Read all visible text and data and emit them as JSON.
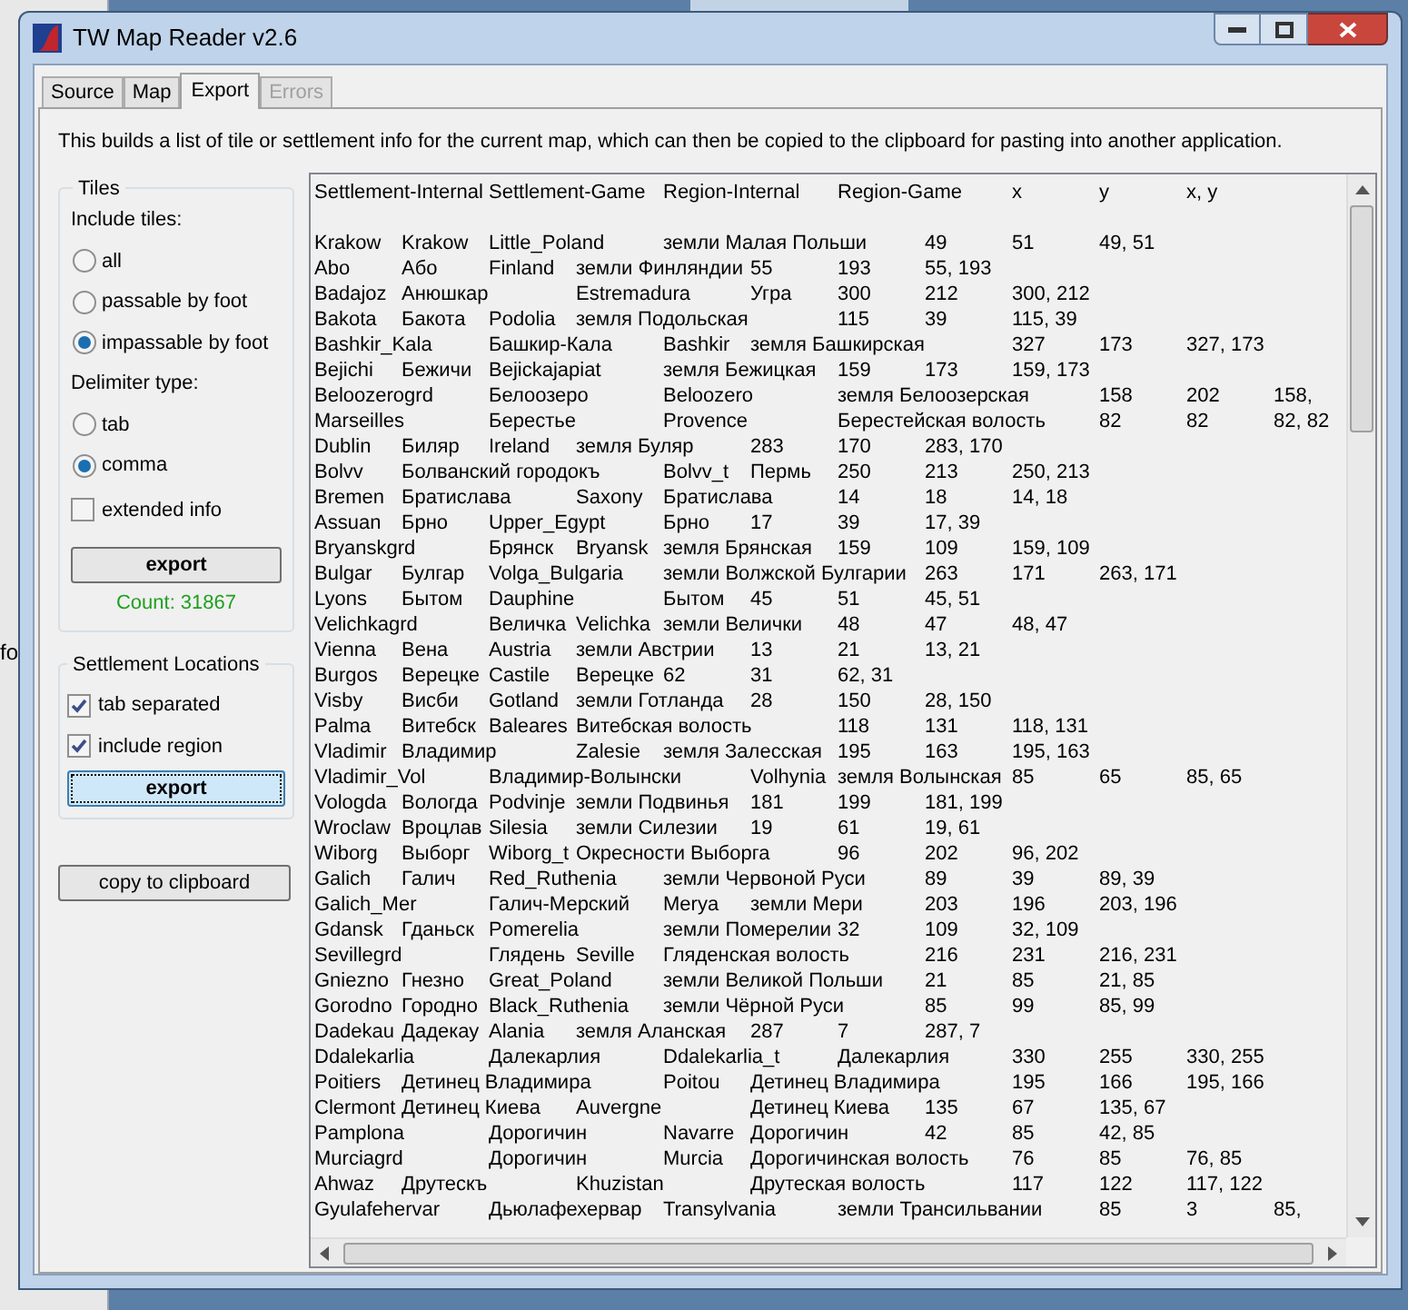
{
  "window": {
    "title": "TW Map Reader v2.6"
  },
  "tabs": [
    {
      "label": "Source",
      "selected": false,
      "disabled": false
    },
    {
      "label": "Map",
      "selected": false,
      "disabled": false
    },
    {
      "label": "Export",
      "selected": true,
      "disabled": false
    },
    {
      "label": "Errors",
      "selected": false,
      "disabled": true
    }
  ],
  "description": "This builds a list of tile or settlement info for the current map, which can then be copied to the clipboard for pasting into another application.",
  "tiles": {
    "title": "Tiles",
    "include_label": "Include tiles:",
    "include_options": [
      {
        "label": "all",
        "selected": false
      },
      {
        "label": "passable by foot",
        "selected": false
      },
      {
        "label": "impassable by foot",
        "selected": true
      }
    ],
    "delimiter_label": "Delimiter type:",
    "delimiter_options": [
      {
        "label": "tab",
        "selected": false
      },
      {
        "label": "comma",
        "selected": true
      }
    ],
    "extended_info": {
      "label": "extended info",
      "checked": false
    },
    "export_button": {
      "label": "export",
      "focused": false
    },
    "count": "Count: 31867"
  },
  "settlement_locations": {
    "title": "Settlement Locations",
    "options": [
      {
        "label": "tab separated",
        "checked": true
      },
      {
        "label": "include region",
        "checked": true
      }
    ],
    "export_button": {
      "label": "export",
      "focused": true
    }
  },
  "copy_button": {
    "label": "copy to clipboard"
  },
  "output": {
    "header": "Settlement-Internal\tSettlement-Game\tRegion-Internal\tRegion-Game\tx\ty\tx, y",
    "rows": [
      "Krakow\tKrakow\tLittle_Poland\tземли Малая Польши\t49\t51\t49, 51",
      "Abo\tАбо\tFinland\tземли Финляндии\t55\t193\t55, 193",
      "Badajoz\tАнюшкар\tEstremadura\tУгра\t300\t212\t300, 212",
      "Bakota\tБакота\tPodolia\tземля Подольская\t115\t39\t115, 39",
      "Bashkir_Kala\tБашкир-Кала\tBashkir\tземля Башкирская\t327\t173\t327, 173",
      "Bejichi\tБежичи\tBejickajapiat\tземля Бежицкая\t159\t173\t159, 173",
      "Beloozerogrd\tБелоозеро\tBeloozero\tземля Белоозерская\t158\t202\t158,",
      "Marseilles\tБерестье\tProvence\tБерестейская волость\t82\t82\t82, 82",
      "Dublin\tБиляр\tIreland\tземля Буляр\t283\t170\t283, 170",
      "Bolvv\tБолванский городокъ\tBolvv_t\tПермь\t250\t213\t250, 213",
      "Bremen\tБратислава\tSaxony\tБратислава\t14\t18\t14, 18",
      "Assuan\tБрно\tUpper_Egypt\tБрно\t17\t39\t17, 39",
      "Bryanskgrd\tБрянск\tBryansk\tземля Брянская\t159\t109\t159, 109",
      "Bulgar\tБулгар\tVolga_Bulgaria\tземли Волжской Булгарии\t263\t171\t263, 171",
      "Lyons\tБытом\tDauphine\tБытом\t45\t51\t45, 51",
      "Velichkagrd\tВеличка\tVelichka\tземли Велички\t48\t47\t48, 47",
      "Vienna\tВена\tAustria\tземли Австрии\t13\t21\t13, 21",
      "Burgos\tВерецке\tCastile\tВерецке\t62\t31\t62, 31",
      "Visby\tВисби\tGotland\tземли Готланда\t28\t150\t28, 150",
      "Palma\tВитебск\tBaleares\tВитебская волость\t118\t131\t118, 131",
      "Vladimir\tВладимир\tZalesie\tземля Залесская\t195\t163\t195, 163",
      "Vladimir_Vol\tВладимир-Волынски\tVolhynia\tземля Волынская\t85\t65\t85, 65",
      "Vologda\tВологда\tPodvinje\tземли Подвинья\t181\t199\t181, 199",
      "Wroclaw\tВроцлав\tSilesia\tземли Силезии\t19\t61\t19, 61",
      "Wiborg\tВыборг\tWiborg_t\tОкресности Выборга\t96\t202\t96, 202",
      "Galich\tГалич\tRed_Ruthenia\tземли Червоной Руси\t89\t39\t89, 39",
      "Galich_Mer\tГалич-Мерский\tMerya\tземли Мери\t203\t196\t203, 196",
      "Gdansk\tГданьск\tPomerelia\tземли Померелии\t32\t109\t32, 109",
      "Sevillegrd\tГлядень\tSeville\tГляденская волость\t216\t231\t216, 231",
      "Gniezno\tГнезно\tGreat_Poland\tземли Великой Польши\t21\t85\t21, 85",
      "Gorodno\tГородно\tBlack_Ruthenia\tземли Чёрной Руси\t85\t99\t85, 99",
      "Dadekau\tДадекау\tAlania\tземля Аланская\t287\t7\t287, 7",
      "Ddalekarlia\tДалекарлия\tDdalekarlia_t\tДалекарлия\t330\t255\t330, 255",
      "Poitiers\tДетинец Владимира\tPoitou\tДетинец Владимира\t195\t166\t195, 166",
      "Clermont\tДетинец Киева\tAuvergne\tДетинец Киева\t135\t67\t135, 67",
      "Pamplona\tДорогичин\tNavarre\tДорогичин\t42\t85\t42, 85",
      "Murciagrd\tДорогичин\tMurcia\tДорогичинская волость\t76\t85\t76, 85",
      "Ahwaz\tДрутескъ\tKhuzistan\tДрутеская волость\t117\t122\t117, 122",
      "Gyulafehervar\tДьюлафехервар\tTransylvania\tземли Трансильвании\t85\t3\t85,"
    ]
  },
  "background_window": {
    "text": "fo"
  }
}
